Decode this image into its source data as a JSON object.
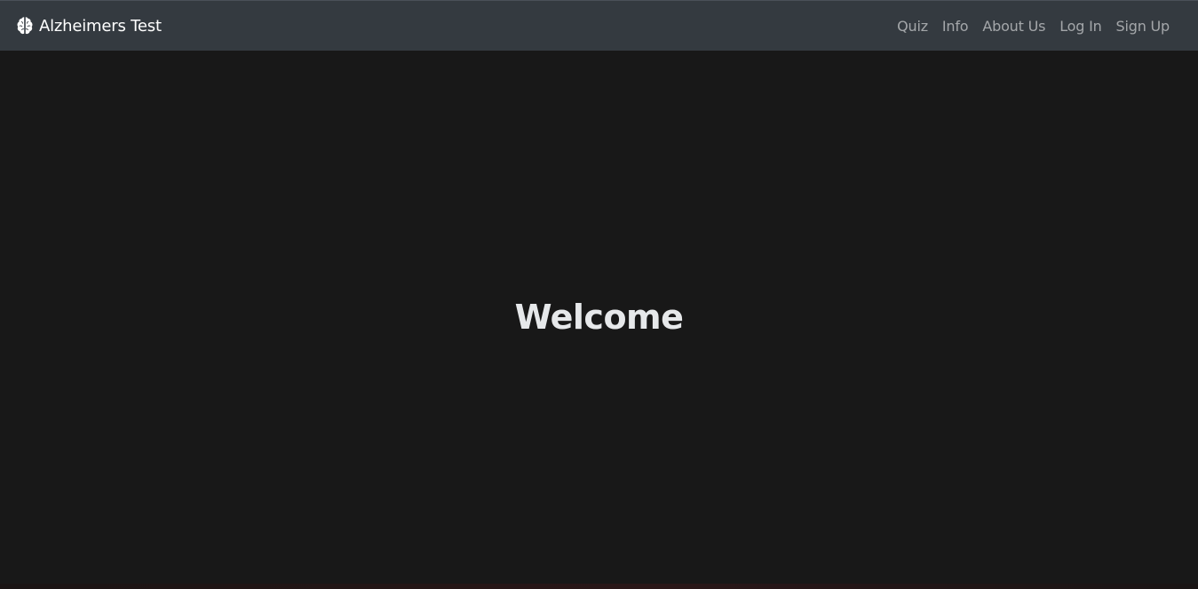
{
  "navbar": {
    "brand": {
      "icon": "brain-icon",
      "label": "Alzheimers Test"
    },
    "links": [
      {
        "label": "Quiz"
      },
      {
        "label": "Info"
      },
      {
        "label": "About Us"
      },
      {
        "label": "Log In"
      },
      {
        "label": "Sign Up"
      }
    ],
    "background": "#343a40",
    "link_color": "#9a9da0"
  },
  "hero": {
    "title": "Welcome",
    "background": "#181818",
    "title_color": "#e6e8ea"
  }
}
